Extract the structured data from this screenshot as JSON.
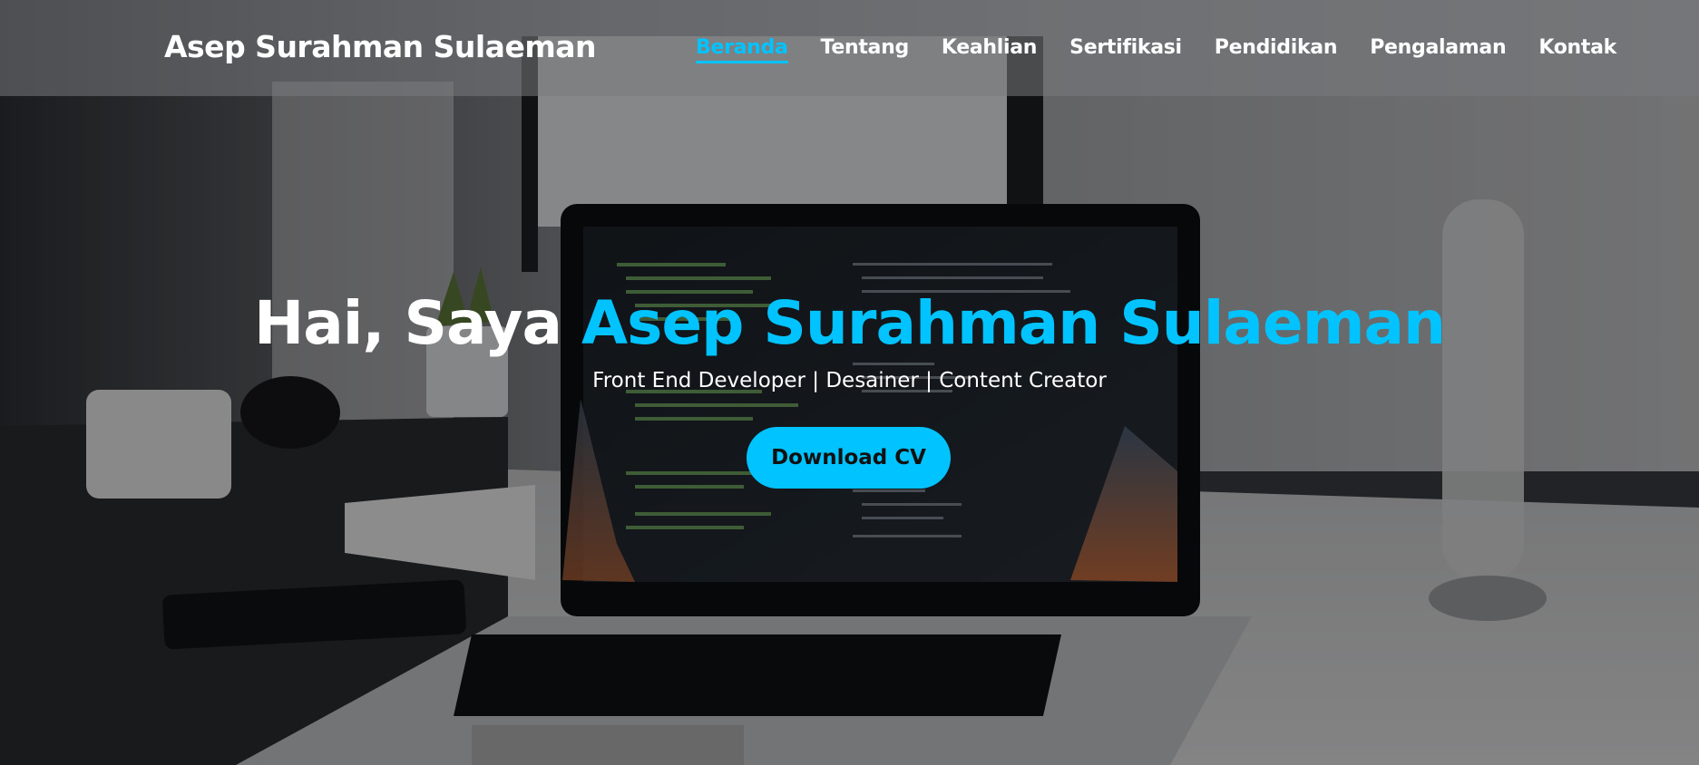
{
  "brand": {
    "name": "Asep Surahman Sulaeman"
  },
  "nav": {
    "items": [
      {
        "label": "Beranda",
        "active": true
      },
      {
        "label": "Tentang",
        "active": false
      },
      {
        "label": "Keahlian",
        "active": false
      },
      {
        "label": "Sertifikasi",
        "active": false
      },
      {
        "label": "Pendidikan",
        "active": false
      },
      {
        "label": "Pengalaman",
        "active": false
      },
      {
        "label": "Kontak",
        "active": false
      }
    ]
  },
  "hero": {
    "greeting": "Hai, Saya ",
    "name": "Asep Surahman Sulaeman",
    "subtitle": "Front End Developer | Desainer | Content Creator",
    "button_label": "Download CV"
  },
  "colors": {
    "accent": "#00c3ff",
    "text": "#ffffff",
    "button_text": "#111111"
  }
}
